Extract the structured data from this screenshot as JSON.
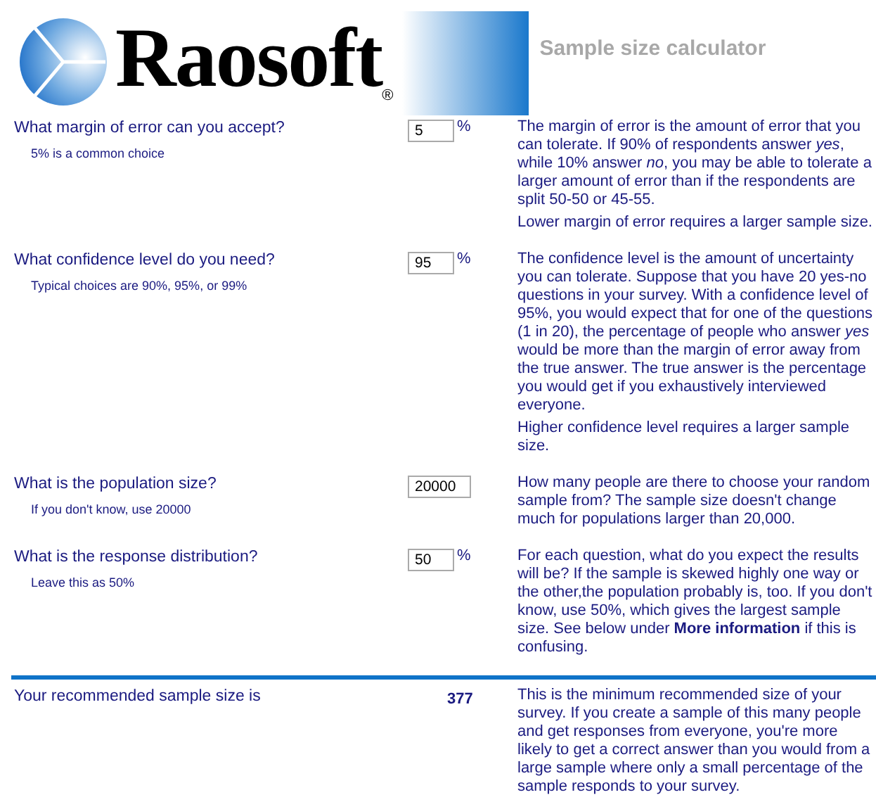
{
  "logo": {
    "name": "Raosoft",
    "mark": "®"
  },
  "title": "Sample size calculator",
  "questions": [
    {
      "label": "What margin of error can you accept?",
      "hint": "5% is a common choice",
      "value": "5",
      "unit": "%",
      "description": [
        "The margin of error is the amount of error that you can tolerate. If 90% of respondents answer *yes*, while 10% answer *no*, you may be able to tolerate a larger amount of error than if the respondents are split 50-50 or 45-55.",
        "Lower margin of error requires a larger sample size."
      ]
    },
    {
      "label": "What confidence level do you need?",
      "hint": "Typical choices are 90%, 95%, or 99%",
      "value": "95",
      "unit": "%",
      "description": [
        "The confidence level is the amount of uncertainty you can tolerate. Suppose that you have 20 yes-no questions in your survey. With a confidence level of 95%, you would expect that for one of the questions (1 in 20), the percentage of people who answer *yes* would be more than the margin of error away from the true answer. The true answer is the percentage you would get if you exhaustively interviewed everyone.",
        "Higher confidence level requires a larger sample size."
      ]
    },
    {
      "label": "What is the population size?",
      "hint": "If you don't know, use 20000",
      "value": "20000",
      "description": [
        "How many people are there to choose your random sample from? The sample size doesn't change much for populations larger than 20,000."
      ]
    },
    {
      "label": "What is the response distribution?",
      "hint": "Leave this as 50%",
      "value": "50",
      "unit": "%",
      "description": [
        "For each question, what do you expect the results will be? If the sample is skewed highly one way or the other,the population probably is, too. If you don't know, use 50%, which gives the largest sample size. See below under **More information** if this is confusing."
      ]
    }
  ],
  "result": {
    "label": "Your recommended sample size is",
    "value": "377",
    "description": [
      "This is the minimum recommended size of your survey. If you create a sample of this many people and get responses from everyone, you're more likely to get a correct answer than you would from a large sample where only a small percentage of the sample responds to your survey."
    ]
  }
}
